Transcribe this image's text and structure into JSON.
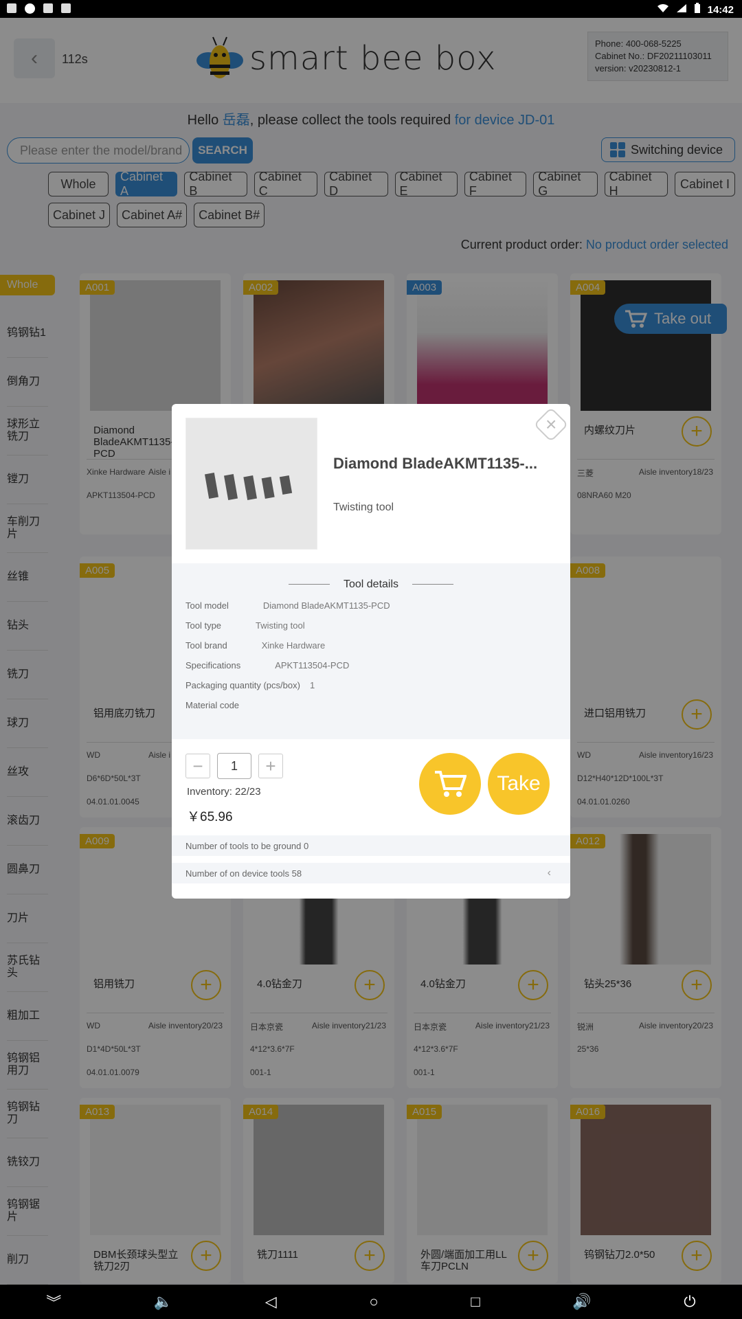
{
  "statusbar": {
    "time": "14:42"
  },
  "header": {
    "countdown": "112s",
    "brand": "smart bee box",
    "phone": "Phone: 400-068-5225",
    "cabinet_no": "Cabinet No.: DF20211103011",
    "version": "version: v20230812-1"
  },
  "greeting": {
    "prefix": "Hello ",
    "name": "岳磊",
    "middle": ", please collect the tools required ",
    "device": "for device JD-01"
  },
  "search": {
    "placeholder": "Please enter the model/brand",
    "button": "SEARCH",
    "switch_label": "Switching device"
  },
  "cabinets_row1": [
    "Whole",
    "Cabinet A",
    "Cabinet B",
    "Cabinet C",
    "Cabinet D",
    "Cabinet E",
    "Cabinet F",
    "Cabinet G",
    "Cabinet H",
    "Cabinet I"
  ],
  "cabinets_row2": [
    "Cabinet J",
    "Cabinet A#",
    "Cabinet B#"
  ],
  "order": {
    "label": "Current product order: ",
    "value": "No product order selected"
  },
  "categories": [
    "Whole",
    "钨钢钻1",
    "倒角刀",
    "球形立铣刀",
    "镗刀",
    "车削刀片",
    "丝锥",
    "钻头",
    "铣刀",
    "球刀",
    "丝攻",
    "滚齿刀",
    "圆鼻刀",
    "刀片",
    "苏氏钻头",
    "粗加工",
    "钨钢铝用刀",
    "钨钢钻刀",
    "铣铰刀",
    "钨钢锯片",
    "削刀"
  ],
  "take_out": "Take out",
  "products": [
    {
      "tag": "A001",
      "name": "Diamond BladeAKMT1135-PCD",
      "brand": "Xinke Hardware",
      "inv": "Aisle i",
      "spec": "APKT113504-PCD",
      "code": ""
    },
    {
      "tag": "A002",
      "name": "",
      "brand": "",
      "inv": "",
      "spec": "",
      "code": ""
    },
    {
      "tag": "A003",
      "name": "",
      "brand": "",
      "inv": "",
      "spec": "",
      "code": ""
    },
    {
      "tag": "A004",
      "name": "内螺纹刀片",
      "brand": "三菱",
      "inv": "Aisle inventory18/23",
      "spec": "08NRA60 M20",
      "code": ""
    },
    {
      "tag": "A005",
      "name": "铝用底刃铣刀",
      "brand": "WD",
      "inv": "Aisle i",
      "spec": "D6*6D*50L*3T",
      "code": "04.01.01.0045"
    },
    {
      "tag": "A008",
      "name": "进口铝用铣刀",
      "brand": "WD",
      "inv": "Aisle inventory16/23",
      "spec": "D12*H40*12D*100L*3T",
      "code": "04.01.01.0260"
    },
    {
      "tag": "A009",
      "name": "铝用铣刀",
      "brand": "WD",
      "inv": "Aisle inventory20/23",
      "spec": "D1*4D*50L*3T",
      "code": "04.01.01.0079"
    },
    {
      "tag": "",
      "name": "4.0钻金刀",
      "brand": "日本京瓷",
      "inv": "Aisle inventory21/23",
      "spec": "4*12*3.6*7F",
      "code": "001-1"
    },
    {
      "tag": "",
      "name": "4.0钻金刀",
      "brand": "日本京瓷",
      "inv": "Aisle inventory21/23",
      "spec": "4*12*3.6*7F",
      "code": "001-1"
    },
    {
      "tag": "A012",
      "name": "钻头25*36",
      "brand": "锐洲",
      "inv": "Aisle inventory20/23",
      "spec": "25*36",
      "code": ""
    },
    {
      "tag": "A013",
      "name": "DBM长颈球头型立铣刀2刃",
      "brand": "",
      "inv": "",
      "spec": "",
      "code": ""
    },
    {
      "tag": "A014",
      "name": "铣刀1111",
      "brand": "",
      "inv": "",
      "spec": "",
      "code": ""
    },
    {
      "tag": "A015",
      "name": "外圆/端面加工用LL车刀PCLN",
      "brand": "",
      "inv": "",
      "spec": "",
      "code": ""
    },
    {
      "tag": "A016",
      "name": "钨钢钻刀2.0*50",
      "brand": "",
      "inv": "",
      "spec": "",
      "code": ""
    }
  ],
  "modal": {
    "title": "Diamond BladeAKMT1135-...",
    "subtitle": "Twisting tool",
    "details_header": "Tool details",
    "rows": [
      {
        "label": "Tool model",
        "value": "Diamond BladeAKMT1135-PCD"
      },
      {
        "label": "Tool type",
        "value": "Twisting tool"
      },
      {
        "label": "Tool brand",
        "value": "Xinke Hardware"
      },
      {
        "label": "Specifications",
        "value": "APKT113504-PCD"
      },
      {
        "label": "Packaging quantity (pcs/box)",
        "value": "1"
      },
      {
        "label": "Material code",
        "value": ""
      }
    ],
    "quantity": "1",
    "inventory_label": "Inventory:",
    "inventory_value": "22/23",
    "price": "￥65.96",
    "take": "Take",
    "ground_label": "Number of tools to be ground",
    "ground_value": "0",
    "ondevice_label": "Number of on device tools",
    "ondevice_value": "58"
  },
  "colors": {
    "accent": "#3a8fd9",
    "yellow": "#f5c419"
  }
}
